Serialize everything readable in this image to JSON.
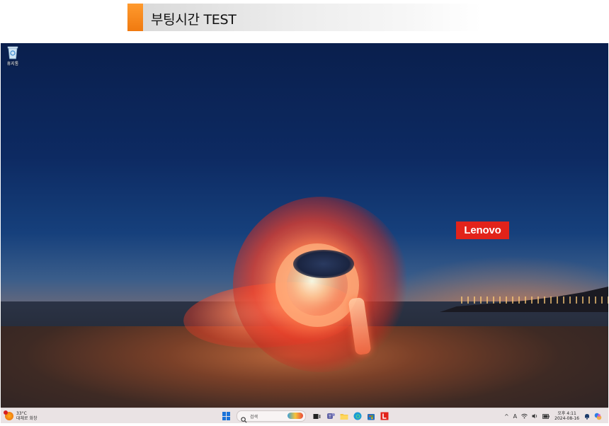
{
  "banner": {
    "title": "부팅시간 TEST"
  },
  "desktop": {
    "icons": [
      {
        "label": "휴지통",
        "icon": "recycle-bin-icon"
      }
    ],
    "wallpaper_logo": "Lenovo"
  },
  "taskbar": {
    "weather": {
      "temp": "33°C",
      "desc": "대체로 화창",
      "badge_count": "1"
    },
    "search": {
      "placeholder": "검색"
    },
    "apps": [
      "start-icon",
      "search-icon",
      "task-view-icon",
      "teams-icon",
      "file-explorer-icon",
      "edge-icon",
      "store-icon",
      "lenovo-vantage-icon"
    ],
    "tray": {
      "chevron": "^",
      "ime": "A",
      "clock_time": "오후 4:11",
      "clock_date": "2024-08-16"
    }
  },
  "colors": {
    "accent": "#f07a10",
    "lenovo_red": "#e2231a",
    "taskbar": "#eae3e4"
  }
}
